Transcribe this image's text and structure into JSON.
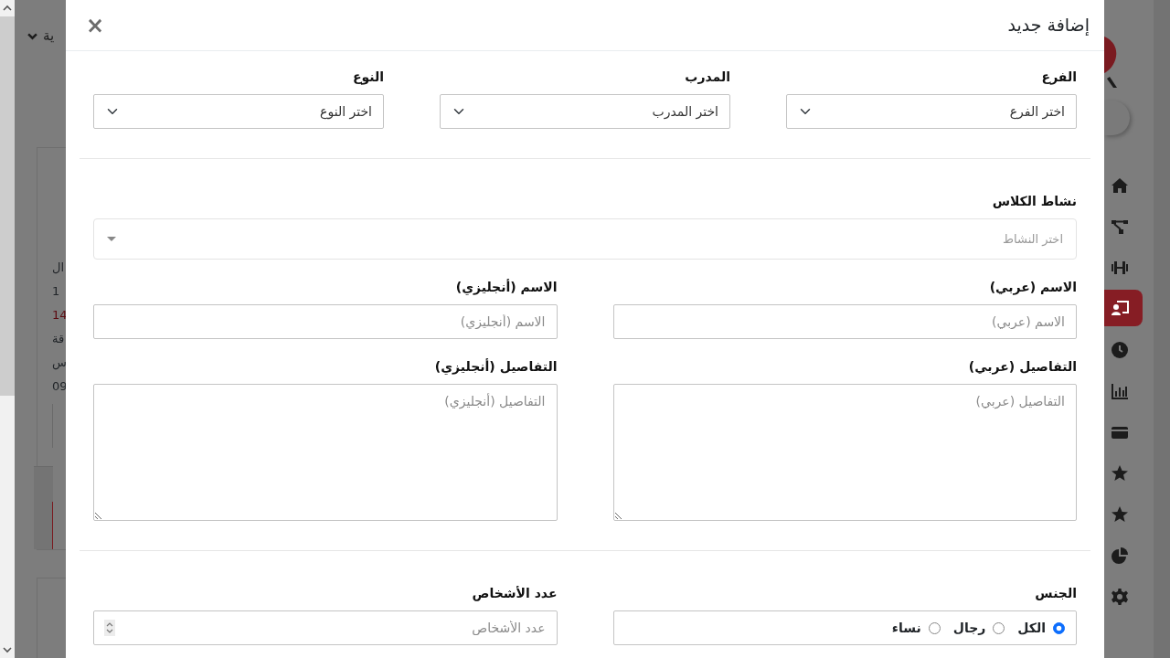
{
  "background": {
    "header_text": "ية",
    "fragments": [
      {
        "text": "ال",
        "color": "#212529"
      },
      {
        "text": "1",
        "color": "#212529"
      },
      {
        "text": "14",
        "color": "#5c0a10"
      },
      {
        "text": "قة",
        "color": "#212529"
      },
      {
        "text": "س",
        "color": "#212529"
      },
      {
        "text": "09",
        "color": "#212529"
      }
    ],
    "sidebar_items": [
      {
        "kind": "home",
        "selected": false
      },
      {
        "kind": "sitemap",
        "selected": false
      },
      {
        "kind": "dumbbell",
        "selected": false
      },
      {
        "kind": "teacher",
        "selected": true
      },
      {
        "kind": "clock",
        "selected": false
      },
      {
        "kind": "chart",
        "selected": false
      },
      {
        "kind": "card",
        "selected": false
      },
      {
        "kind": "star",
        "selected": false
      },
      {
        "kind": "star",
        "selected": false
      },
      {
        "kind": "pie",
        "selected": false
      },
      {
        "kind": "gear",
        "selected": false
      }
    ]
  },
  "modal": {
    "title": "إضافة جديد",
    "close": "×",
    "sections": [
      {
        "rows": [
          {
            "fields": [
              {
                "kind": "select",
                "label": "الفرع",
                "value": "اختر الفرع"
              },
              {
                "kind": "select",
                "label": "المدرب",
                "value": "اختر المدرب"
              },
              {
                "kind": "select",
                "label": "النوع",
                "value": "اختر النوع"
              }
            ]
          }
        ]
      },
      {
        "rows": [
          {
            "fields": [
              {
                "kind": "select2",
                "label": "نشاط الكلاس",
                "placeholder": "اختر النشاط"
              }
            ]
          },
          {
            "fields": [
              {
                "kind": "input",
                "label": "الاسم (عربي)",
                "placeholder": "الاسم (عربي)"
              },
              {
                "kind": "input",
                "label": "الاسم (أنجليزي)",
                "placeholder": "الاسم (أنجليزي)"
              }
            ]
          },
          {
            "fields": [
              {
                "kind": "textarea",
                "label": "التفاصيل (عربي)",
                "placeholder": "التفاصيل (عربي)"
              },
              {
                "kind": "textarea",
                "label": "التفاصيل (أنجليزي)",
                "placeholder": "التفاصيل (أنجليزي)"
              }
            ]
          }
        ]
      },
      {
        "rows": [
          {
            "fields": [
              {
                "kind": "radio",
                "label": "الجنس",
                "options": [
                  {
                    "label": "الكل",
                    "selected": true
                  },
                  {
                    "label": "رجال",
                    "selected": false
                  },
                  {
                    "label": "نساء",
                    "selected": false
                  }
                ]
              },
              {
                "kind": "number",
                "label": "عدد الأشخاص",
                "placeholder": "عدد الأشخاص"
              }
            ]
          }
        ]
      }
    ]
  }
}
